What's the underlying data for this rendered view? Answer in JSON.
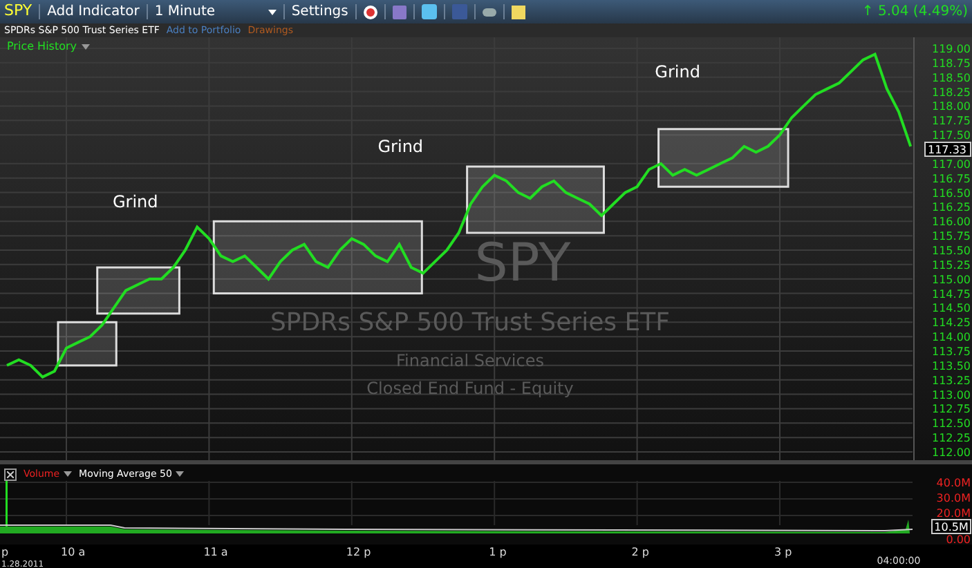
{
  "toolbar": {
    "symbol": "SPY",
    "add_indicator": "Add Indicator",
    "interval": {
      "value": "1 Minute"
    },
    "settings": "Settings",
    "change": {
      "arrow": "↑",
      "text": "5.04 (4.49%)"
    }
  },
  "subtitle": {
    "name": "SPDRs S&P 500 Trust Series ETF",
    "add_to_portfolio": "Add to Portfolio",
    "drawings": "Drawings"
  },
  "price_panel": {
    "title": "Price History",
    "watermark": {
      "symbol": "SPY",
      "name": "SPDRs S&P 500 Trust Series ETF",
      "sector": "Financial Services",
      "category": "Closed End Fund - Equity"
    },
    "last_price": "117.33",
    "grind_labels": [
      "Grind",
      "Grind",
      "Grind"
    ],
    "chart_data": {
      "type": "line",
      "categories": [
        "p",
        null,
        null,
        null,
        null,
        "10 a",
        null,
        null,
        null,
        null,
        null,
        null,
        null,
        null,
        null,
        null,
        null,
        "11 a",
        null,
        null,
        null,
        null,
        null,
        null,
        null,
        null,
        null,
        null,
        null,
        "12 p",
        null,
        null,
        null,
        null,
        null,
        null,
        null,
        null,
        null,
        null,
        null,
        "1 p",
        null,
        null,
        null,
        null,
        null,
        null,
        null,
        null,
        null,
        null,
        null,
        "2 p",
        null,
        null,
        null,
        null,
        null,
        null,
        null,
        null,
        null,
        null,
        null,
        "3 p",
        null,
        null,
        null,
        null,
        null,
        null,
        null,
        null,
        null,
        null,
        null
      ],
      "series": [
        {
          "color": "#22dd22",
          "values": [
            113.5,
            113.6,
            113.5,
            113.3,
            113.4,
            113.8,
            113.9,
            114.0,
            114.2,
            114.5,
            114.8,
            114.9,
            115.0,
            115.0,
            115.2,
            115.5,
            115.9,
            115.7,
            115.4,
            115.3,
            115.4,
            115.2,
            115.0,
            115.3,
            115.5,
            115.6,
            115.3,
            115.2,
            115.5,
            115.7,
            115.6,
            115.4,
            115.3,
            115.6,
            115.2,
            115.1,
            115.3,
            115.5,
            115.8,
            116.3,
            116.6,
            116.8,
            116.7,
            116.5,
            116.4,
            116.6,
            116.7,
            116.5,
            116.4,
            116.3,
            116.1,
            116.3,
            116.5,
            116.6,
            116.9,
            117.0,
            116.8,
            116.9,
            116.8,
            116.9,
            117.0,
            117.1,
            117.3,
            117.2,
            117.3,
            117.5,
            117.8,
            118.0,
            118.2,
            118.3,
            118.4,
            118.6,
            118.8,
            118.9,
            118.3,
            117.9,
            117.3
          ]
        }
      ],
      "ylim": [
        112,
        119
      ],
      "grid": true,
      "yticks": [
        {
          "value": 112,
          "label": "112.00"
        },
        {
          "value": 112.25,
          "label": "112.25"
        },
        {
          "value": 112.5,
          "label": "112.50"
        },
        {
          "value": 112.75,
          "label": "112.75"
        },
        {
          "value": 113,
          "label": "113.00"
        },
        {
          "value": 113.25,
          "label": "113.25"
        },
        {
          "value": 113.5,
          "label": "113.50"
        },
        {
          "value": 113.75,
          "label": "113.75"
        },
        {
          "value": 114,
          "label": "114.00"
        },
        {
          "value": 114.25,
          "label": "114.25"
        },
        {
          "value": 114.5,
          "label": "114.50"
        },
        {
          "value": 114.75,
          "label": "114.75"
        },
        {
          "value": 115,
          "label": "115.00"
        },
        {
          "value": 115.25,
          "label": "115.25"
        },
        {
          "value": 115.5,
          "label": "115.50"
        },
        {
          "value": 115.75,
          "label": "115.75"
        },
        {
          "value": 116,
          "label": "116.00"
        },
        {
          "value": 116.25,
          "label": "116.25"
        },
        {
          "value": 116.5,
          "label": "116.50"
        },
        {
          "value": 116.75,
          "label": "116.75"
        },
        {
          "value": 117,
          "label": "117.00"
        },
        {
          "value": 117.5,
          "label": "117.50"
        },
        {
          "value": 117.75,
          "label": "117.75"
        },
        {
          "value": 118,
          "label": "118.00"
        },
        {
          "value": 118.25,
          "label": "118.25"
        },
        {
          "value": 118.5,
          "label": "118.50"
        },
        {
          "value": 118.75,
          "label": "118.75"
        },
        {
          "value": 119,
          "label": "119.00"
        }
      ]
    }
  },
  "volume_panel": {
    "volume": "Volume",
    "moving_average": "Moving Average 50",
    "y_labels": [
      "40.0M",
      "30.0M",
      "20.0M",
      "0.00"
    ],
    "last_volume": "10.5M"
  },
  "time_axis": {
    "end_time": "04:00:00",
    "date": "1.28.2011"
  }
}
